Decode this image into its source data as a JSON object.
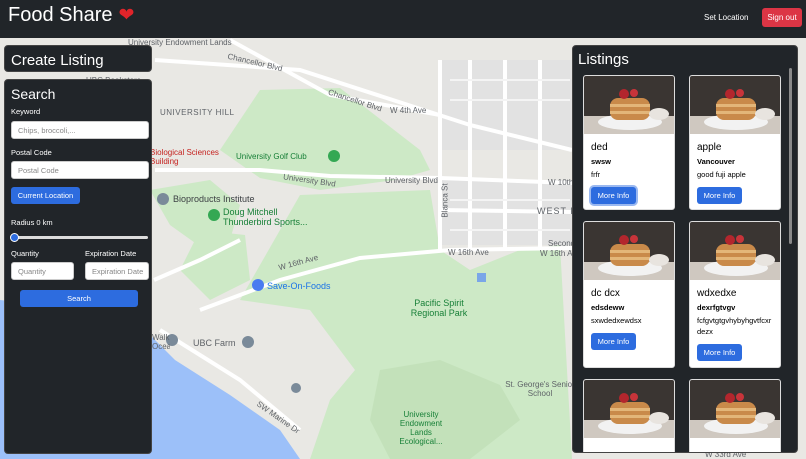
{
  "navbar": {
    "brand": "Food Share",
    "brand_icon": "heart-icon",
    "set_location": "Set Location",
    "sign_out": "Sign out"
  },
  "map": {
    "labels": [
      "University Endowment Lands",
      "Chancellor Blvd",
      "Chancellor Blvd",
      "W 4th Ave",
      "UNIVERSITY HILL",
      "UBC Bookstore",
      "Biological Sciences Building",
      "University Golf Club",
      "University Blvd",
      "University Blvd",
      "W 10th",
      "Bioproducts Institute",
      "Doug Mitchell Thunderbird Sports...",
      "Blanca St",
      "WEST POINT GREY",
      "Secondary",
      "W 16th Ave",
      "W 16th Ave",
      "W 16th Ave",
      "Save-On-Foods",
      "Pacific Spirit Regional Park",
      "UBC Farm",
      "Walk Ocean",
      "SW Marine Dr",
      "St. George's Senior School",
      "University Endowment Lands Ecological...",
      "W 33rd Ave"
    ]
  },
  "create_listing": {
    "title": "Create Listing"
  },
  "search": {
    "title": "Search",
    "keyword_label": "Keyword",
    "keyword_placeholder": "Chips, broccoli,...",
    "postal_label": "Postal Code",
    "postal_placeholder": "Postal Code",
    "current_location": "Current Location",
    "radius_label": "Radius 0 km",
    "radius_value": 0,
    "quantity_label": "Quantity",
    "quantity_placeholder": "Quantity",
    "expiration_label": "Expiration Date",
    "expiration_placeholder": "Expiration Date",
    "search_button": "Search"
  },
  "listings": {
    "title": "Listings",
    "more_info": "More Info",
    "items": [
      {
        "title": "ded",
        "user": "swsw",
        "desc": "frfr"
      },
      {
        "title": "apple",
        "user": "Vancouver",
        "desc": "good fuji apple"
      },
      {
        "title": "dc dcx",
        "user": "edsdeww",
        "desc": "sxwdedxewdsx"
      },
      {
        "title": "wdxedxe",
        "user": "dexrfgtvgv",
        "desc": "fcfgvtgtgvhybyhgvtfcxr dezx"
      }
    ]
  }
}
